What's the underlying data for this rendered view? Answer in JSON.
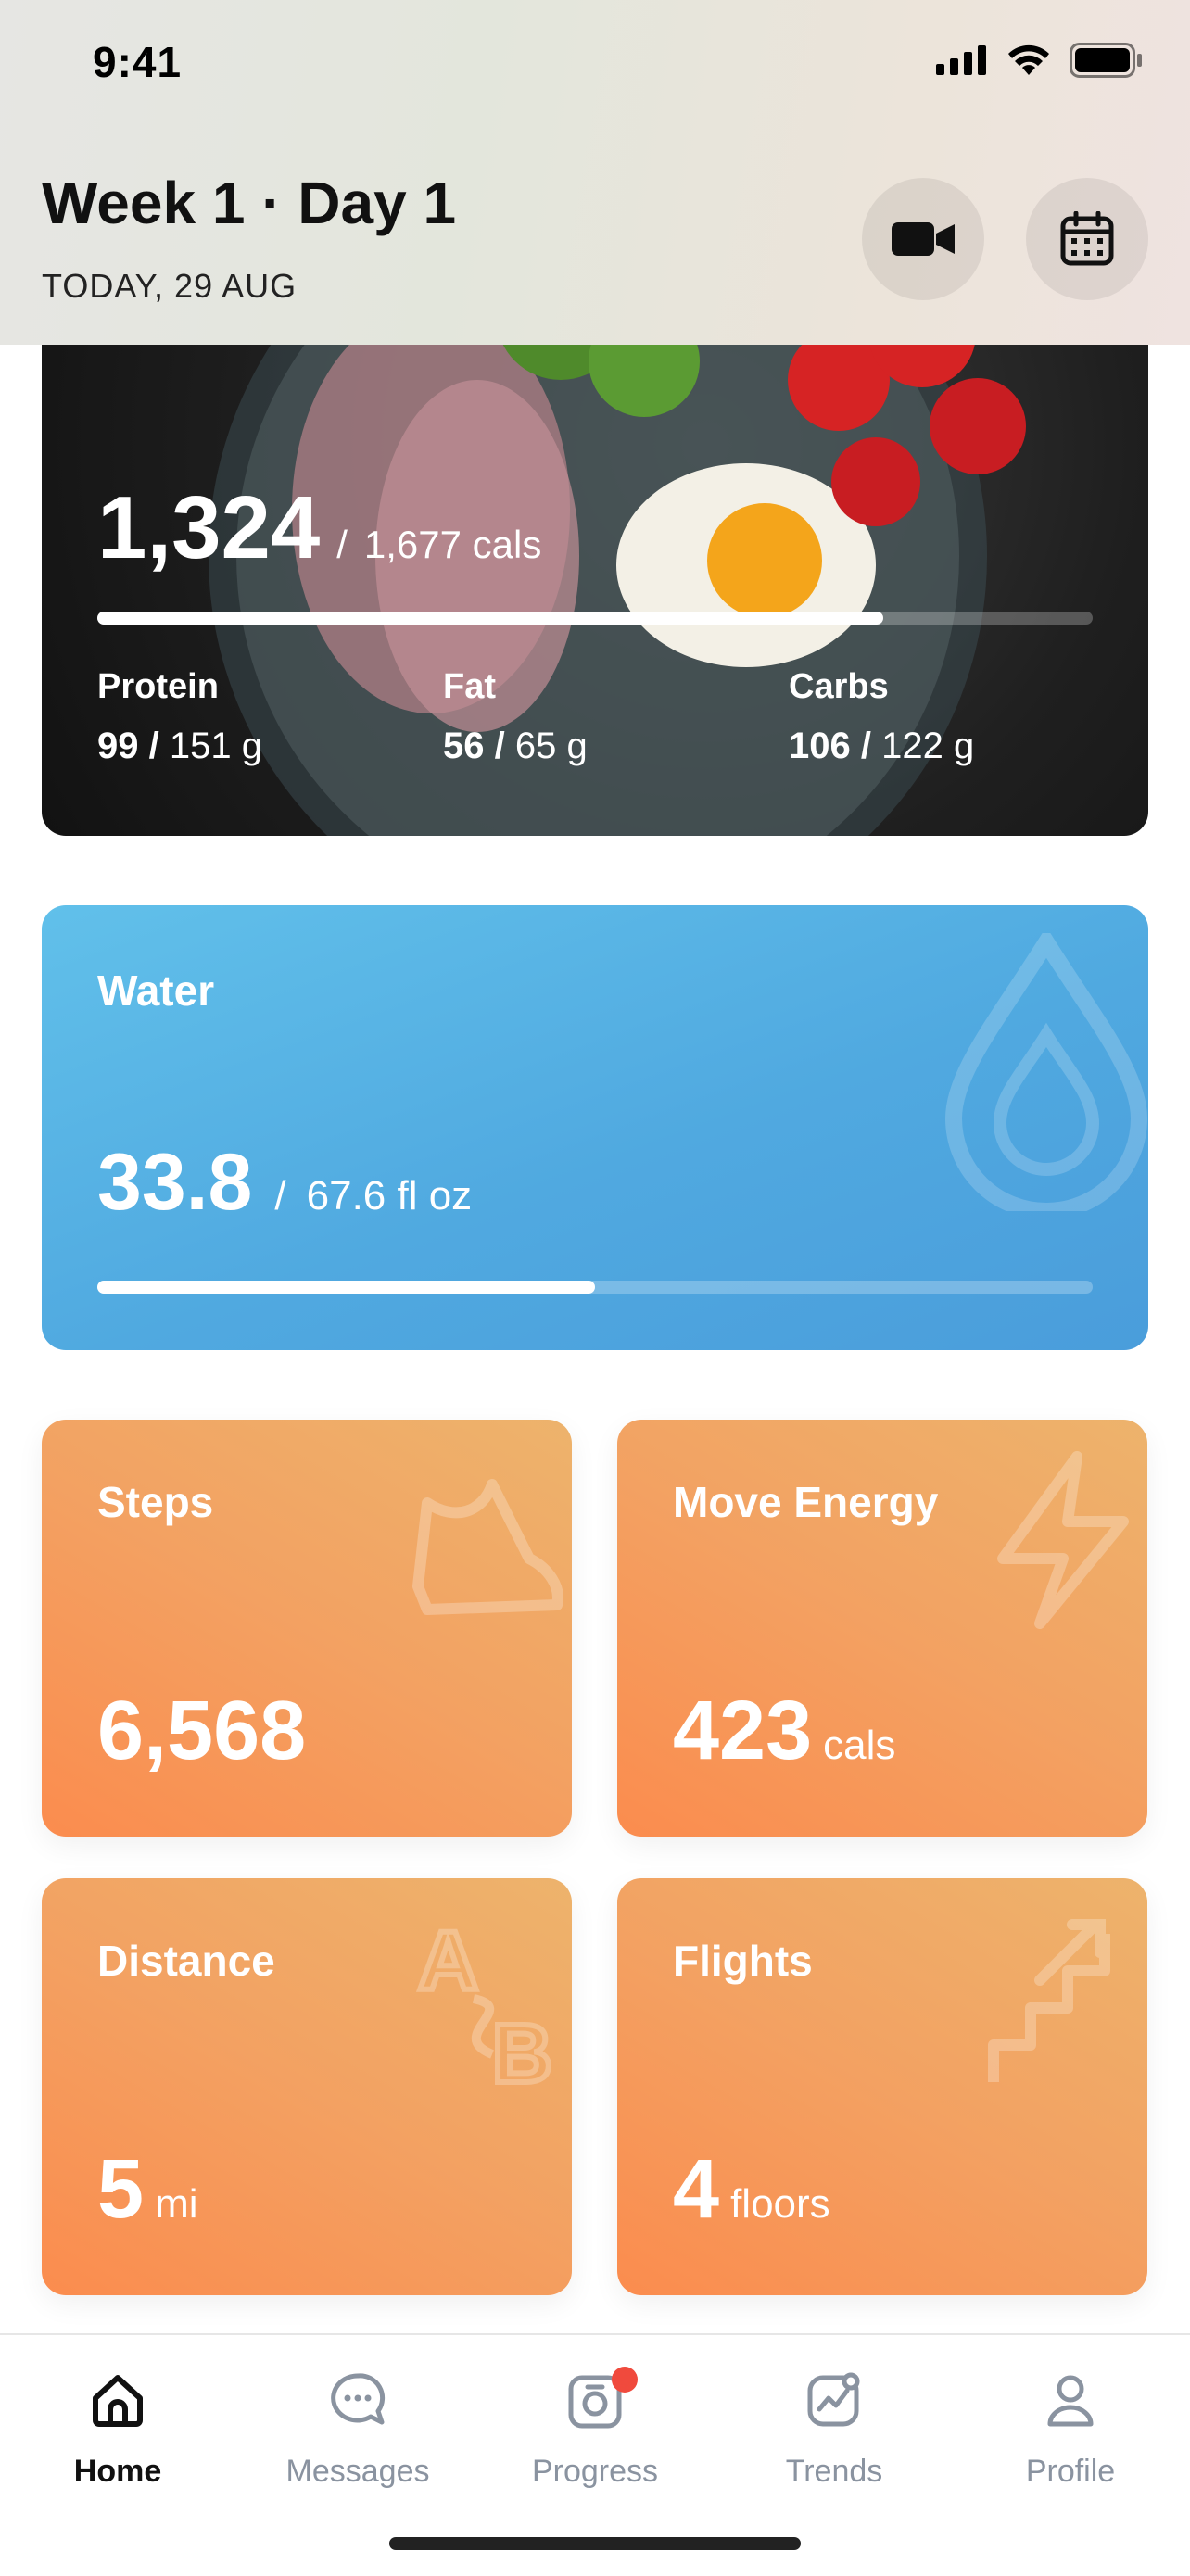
{
  "status_bar": {
    "time": "9:41"
  },
  "header": {
    "title": "Week 1 · Day 1",
    "date": "TODAY, 29 AUG"
  },
  "calories": {
    "consumed": "1,324",
    "goal": "1,677 cals",
    "progress": 0.79,
    "macros": [
      {
        "label": "Protein",
        "value": "99",
        "goal": "151 g"
      },
      {
        "label": "Fat",
        "value": "56",
        "goal": "65 g"
      },
      {
        "label": "Carbs",
        "value": "106",
        "goal": "122 g"
      }
    ]
  },
  "water": {
    "label": "Water",
    "value": "33.8",
    "goal": "67.6 fl oz",
    "progress": 0.5
  },
  "tiles": {
    "steps": {
      "label": "Steps",
      "value": "6,568"
    },
    "move_energy": {
      "label": "Move Energy",
      "value": "423",
      "unit": "cals"
    },
    "distance": {
      "label": "Distance",
      "value": "5",
      "unit": "mi"
    },
    "flights": {
      "label": "Flights",
      "value": "4",
      "unit": "floors"
    }
  },
  "tabbar": {
    "items": [
      {
        "label": "Home",
        "icon": "home-icon",
        "active": true
      },
      {
        "label": "Messages",
        "icon": "messages-icon"
      },
      {
        "label": "Progress",
        "icon": "progress-icon",
        "badge": true
      },
      {
        "label": "Trends",
        "icon": "trends-icon"
      },
      {
        "label": "Profile",
        "icon": "profile-icon"
      }
    ]
  },
  "colors": {
    "water": "#50a9e0",
    "tile_orange": "#f3a162",
    "badge": "#f04a3d",
    "tab_inactive": "#8a93a0"
  }
}
